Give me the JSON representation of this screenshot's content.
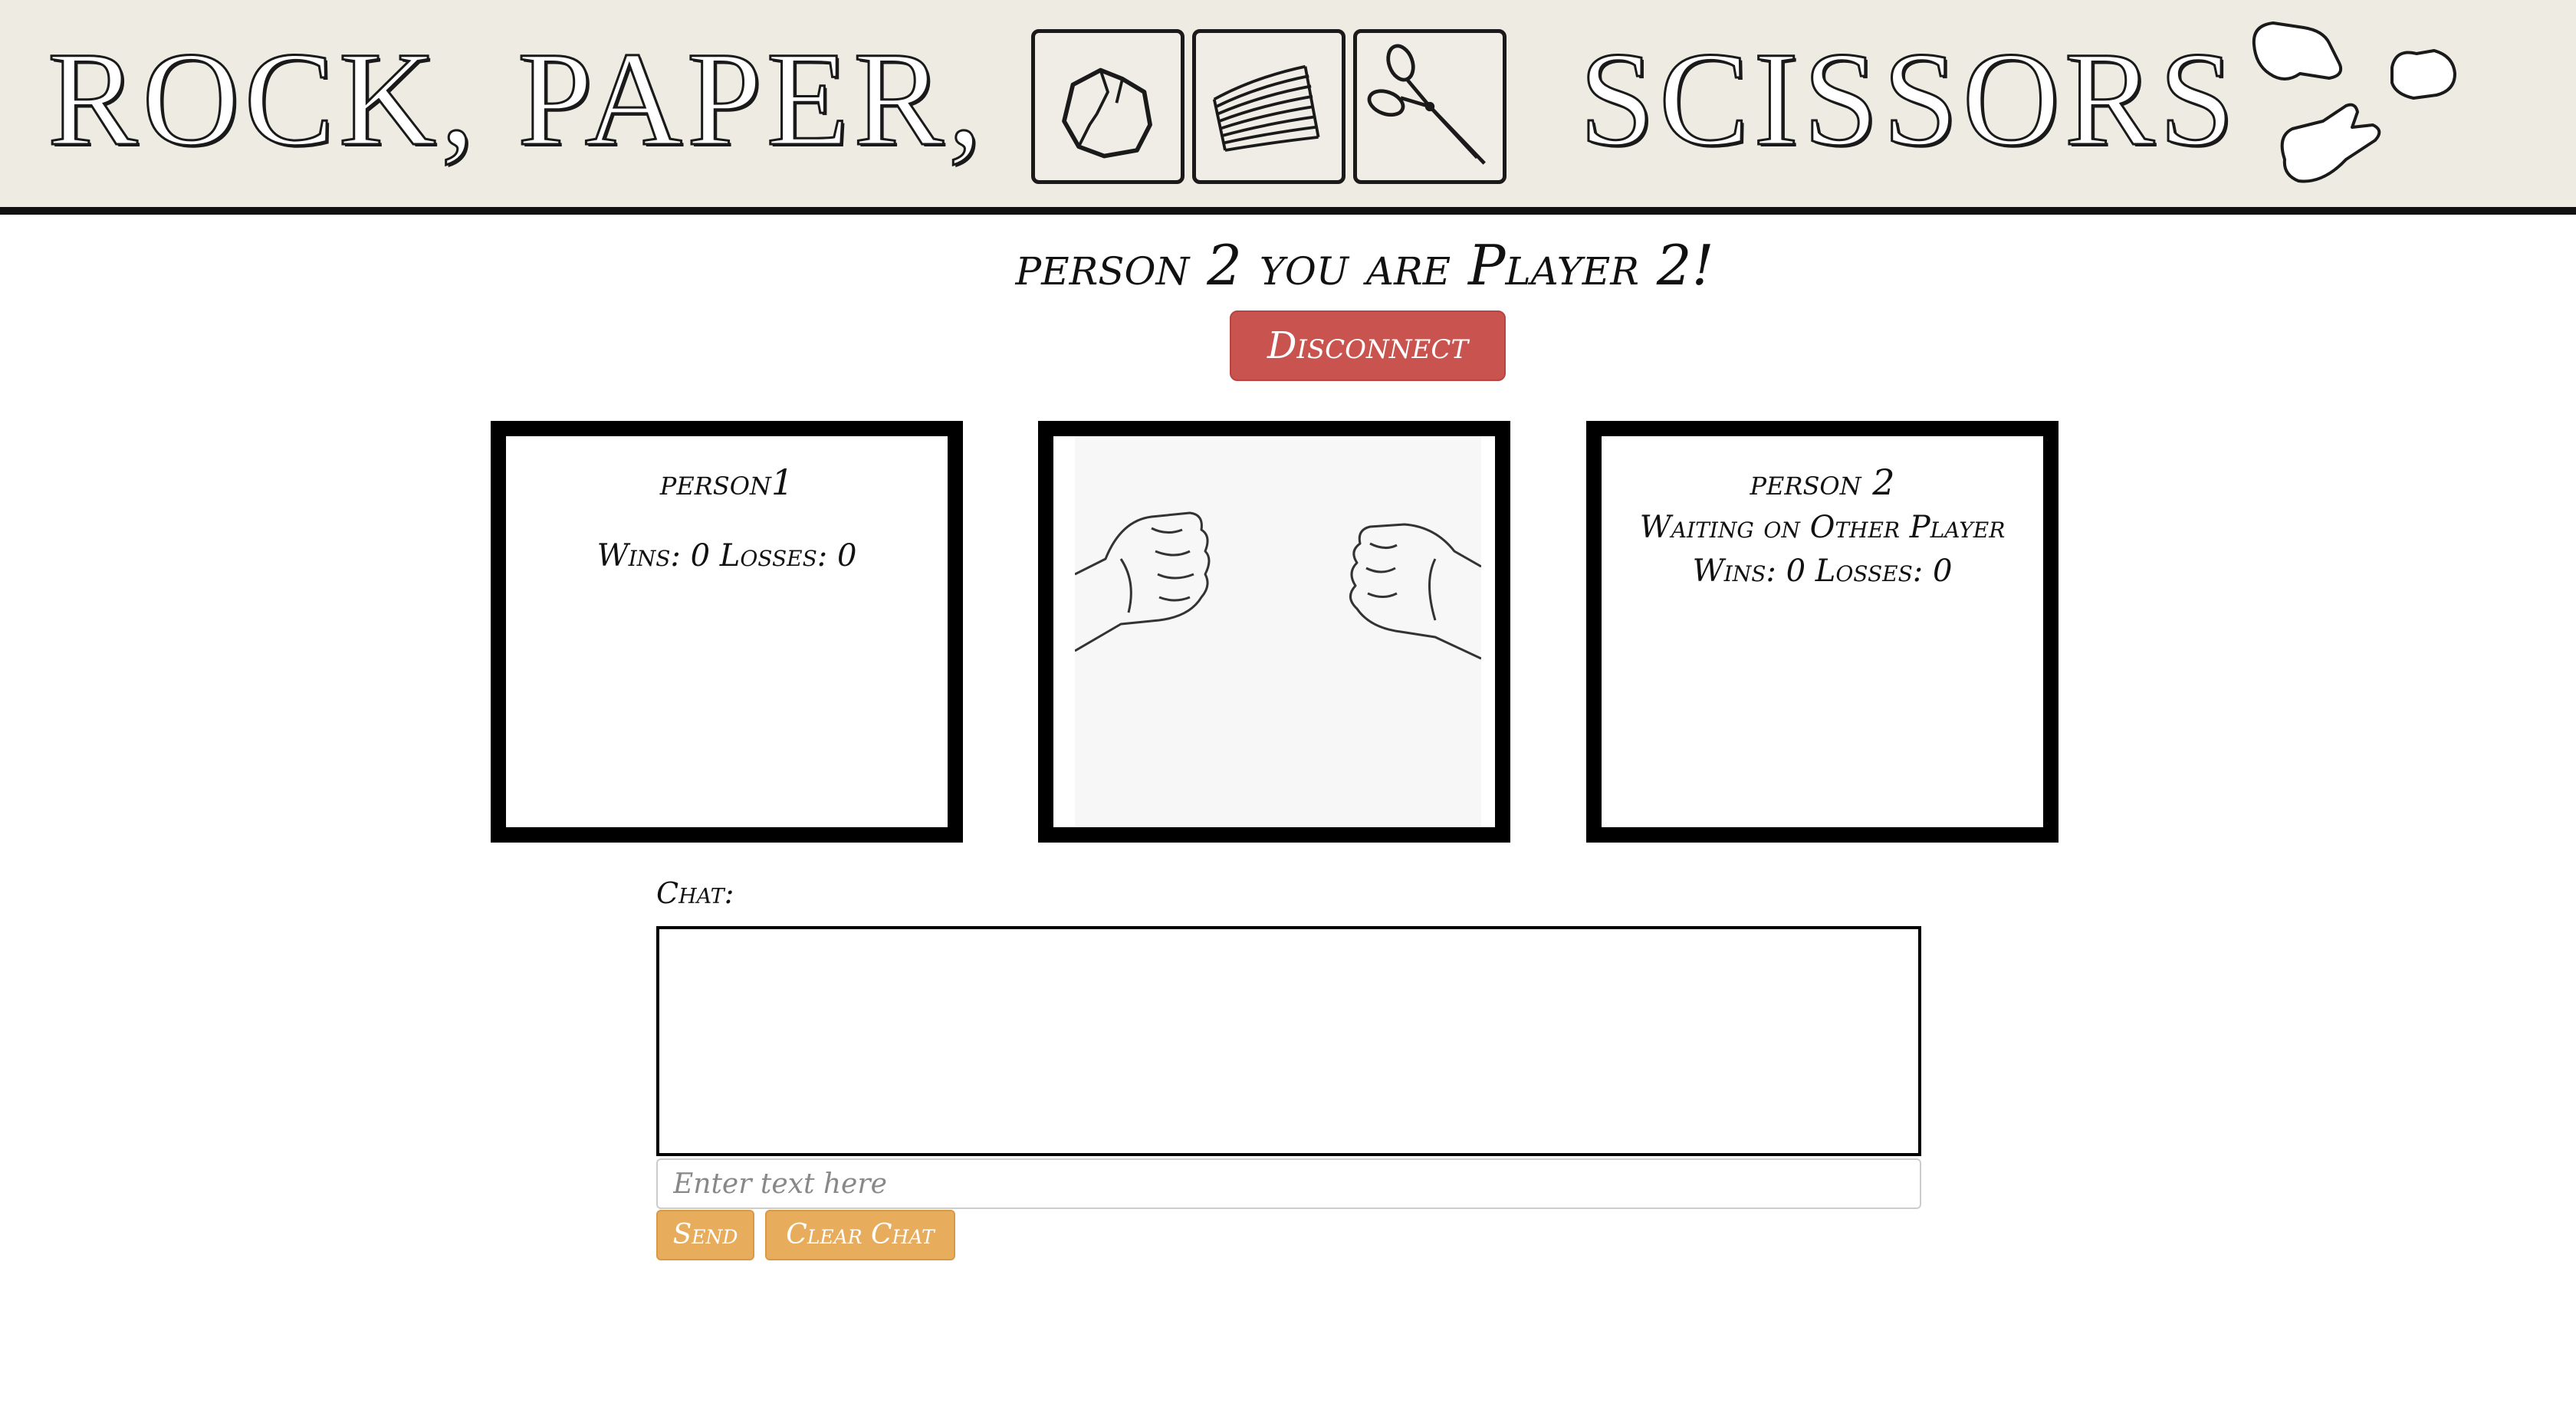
{
  "banner": {
    "title_part1": "ROCK, PAPER,",
    "title_part2": "SCISSORS",
    "icons": [
      "rock-icon",
      "paper-icon",
      "scissors-icon"
    ],
    "decoration": "cartoon-gloves-icon"
  },
  "greeting": "person 2 you are Player 2!",
  "disconnect_label": "Disconnect",
  "player1": {
    "name": "person1",
    "score": "Wins: 0 Losses: 0"
  },
  "arena": {
    "left_hand": "rock-fist-icon",
    "right_hand": "rock-fist-icon"
  },
  "player2": {
    "name": "person 2",
    "status": "Waiting on Other Player",
    "score": "Wins: 0 Losses: 0"
  },
  "chat": {
    "label": "Chat:",
    "input_value": "",
    "input_placeholder": "Enter text here",
    "send_label": "Send",
    "clear_label": "Clear Chat"
  },
  "colors": {
    "banner_bg": "#eeebe2",
    "disconnect": "#c9534f",
    "action_button": "#e8ad5c",
    "panel_border": "#000000"
  }
}
